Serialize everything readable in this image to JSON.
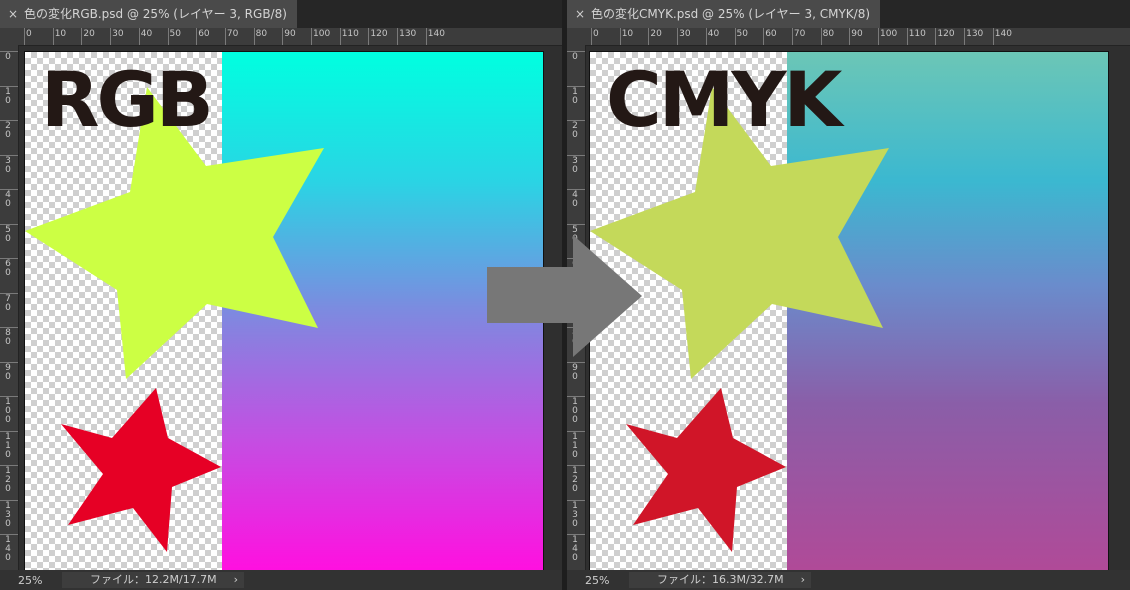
{
  "left_document": {
    "tab_title": "色の変化RGB.psd @ 25% (レイヤー 3, RGB/8)",
    "close_icon": "×",
    "canvas_text": "RGB",
    "zoom": "25%",
    "file_info": "ファイル：12.2M/17.7M",
    "chevron": "›",
    "ruler_h": [
      "0",
      "10",
      "20",
      "30",
      "40",
      "50",
      "60",
      "70",
      "80",
      "90",
      "100",
      "110",
      "120",
      "130",
      "140"
    ],
    "ruler_v": [
      "0",
      "10",
      "20",
      "30",
      "40",
      "50",
      "60",
      "70",
      "80",
      "90",
      "100",
      "110",
      "120",
      "130",
      "140"
    ]
  },
  "right_document": {
    "tab_title": "色の変化CMYK.psd @ 25% (レイヤー 3, CMYK/8)",
    "close_icon": "×",
    "canvas_text": "CMYK",
    "zoom": "25%",
    "file_info": "ファイル：16.3M/32.7M",
    "chevron": "›",
    "ruler_h": [
      "0",
      "10",
      "20",
      "30",
      "40",
      "50",
      "60",
      "70",
      "80",
      "90",
      "100",
      "110",
      "120",
      "130",
      "140"
    ],
    "ruler_v": [
      "0",
      "10",
      "20",
      "30",
      "40",
      "50",
      "60",
      "70",
      "80",
      "90",
      "100",
      "110",
      "120",
      "130",
      "140"
    ]
  },
  "colors": {
    "rgb_star_yellow": "#ccff44",
    "rgb_star_red": "#e60025",
    "cmyk_star_yellow": "#c4d95a",
    "cmyk_star_red": "#d01528",
    "arrow": "#777777",
    "text": "#231815"
  },
  "icons": {
    "close": "close-icon",
    "chevron": "chevron-right-icon",
    "arrow": "arrow-right-icon"
  }
}
